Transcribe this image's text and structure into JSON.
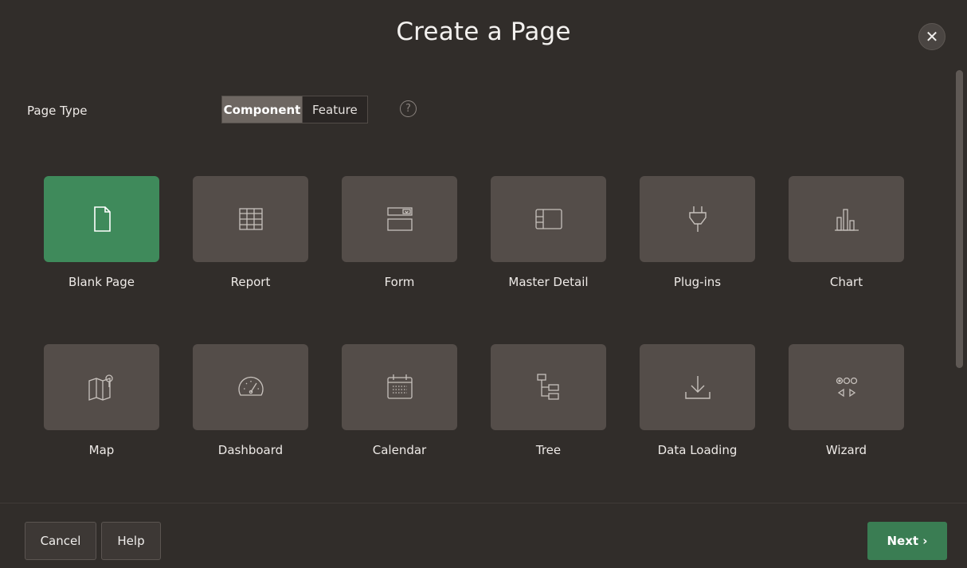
{
  "dialog": {
    "title": "Create a Page",
    "close_label": "✕"
  },
  "page_type": {
    "label": "Page Type",
    "options": [
      "Component",
      "Feature"
    ],
    "selected": "Component",
    "help_symbol": "?"
  },
  "tiles": [
    {
      "label": "Blank Page",
      "icon": "blank-page-icon",
      "selected": true
    },
    {
      "label": "Report",
      "icon": "report-icon"
    },
    {
      "label": "Form",
      "icon": "form-icon"
    },
    {
      "label": "Master Detail",
      "icon": "master-detail-icon"
    },
    {
      "label": "Plug-ins",
      "icon": "plug-icon"
    },
    {
      "label": "Chart",
      "icon": "chart-icon"
    },
    {
      "label": "Map",
      "icon": "map-icon"
    },
    {
      "label": "Dashboard",
      "icon": "dashboard-icon"
    },
    {
      "label": "Calendar",
      "icon": "calendar-icon"
    },
    {
      "label": "Tree",
      "icon": "tree-icon"
    },
    {
      "label": "Data Loading",
      "icon": "data-loading-icon"
    },
    {
      "label": "Wizard",
      "icon": "wizard-icon"
    }
  ],
  "footer": {
    "cancel_label": "Cancel",
    "help_label": "Help",
    "next_label": "Next ›"
  },
  "colors": {
    "background": "#312d2a",
    "tile": "#544d49",
    "selected_tile": "#3f8a5b",
    "next_button": "#3a7d53"
  }
}
